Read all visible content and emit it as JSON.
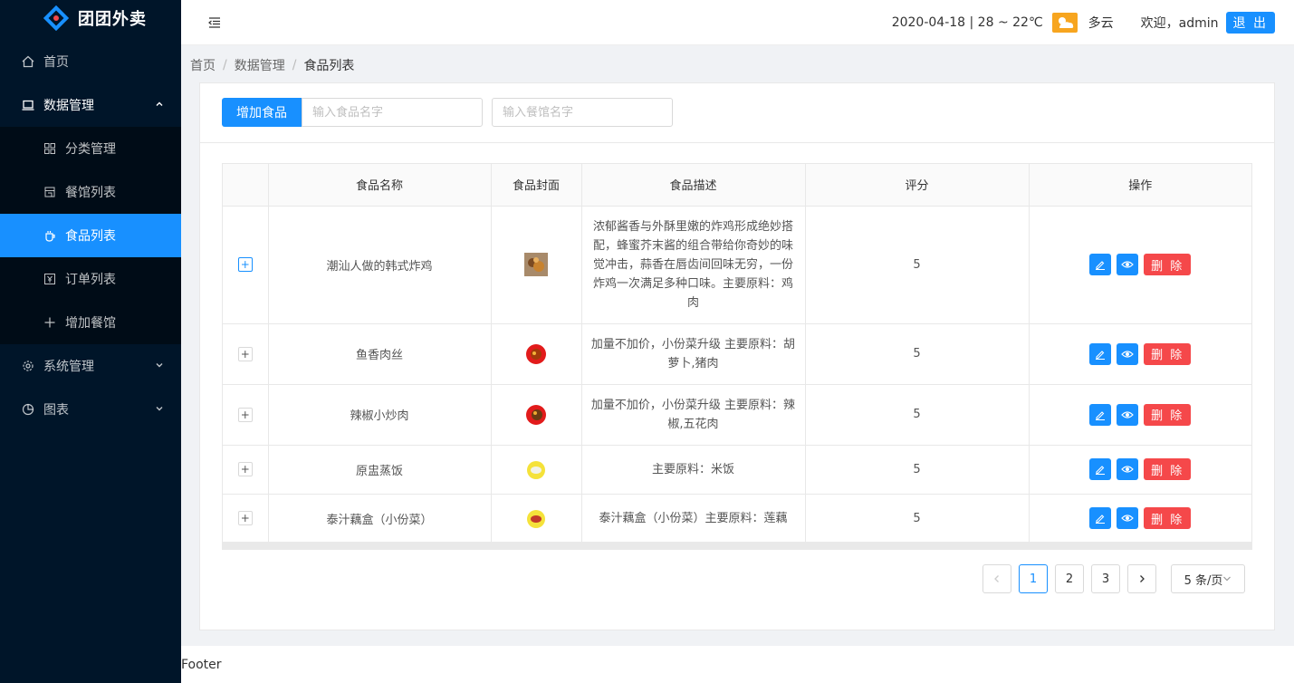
{
  "app": {
    "name": "团团外卖"
  },
  "sidebar": {
    "items": [
      {
        "label": "首页",
        "icon": "home-icon"
      },
      {
        "label": "数据管理",
        "icon": "laptop-icon",
        "open": true,
        "children": [
          {
            "label": "分类管理",
            "icon": "grid-icon"
          },
          {
            "label": "餐馆列表",
            "icon": "shop-icon"
          },
          {
            "label": "食品列表",
            "icon": "coffee-icon",
            "active": true
          },
          {
            "label": "订单列表",
            "icon": "yen-icon"
          },
          {
            "label": "增加餐馆",
            "icon": "plus-icon"
          }
        ]
      },
      {
        "label": "系统管理",
        "icon": "gear-icon"
      },
      {
        "label": "图表",
        "icon": "pie-chart-icon"
      }
    ]
  },
  "header": {
    "weather_info": "2020-04-18 | 28 ~ 22℃",
    "weather_desc": "多云",
    "welcome": "欢迎，admin",
    "logout_label": "退 出"
  },
  "breadcrumb": {
    "home": "首页",
    "section": "数据管理",
    "current": "食品列表"
  },
  "toolbar": {
    "add_label": "增加食品",
    "food_placeholder": "输入食品名字",
    "restaurant_placeholder": "输入餐馆名字"
  },
  "table": {
    "headers": {
      "name": "食品名称",
      "cover": "食品封面",
      "desc": "食品描述",
      "rating": "评分",
      "ops": "操作"
    },
    "rows": [
      {
        "name": "潮汕人做的韩式炸鸡",
        "desc": "浓郁酱香与外酥里嫩的炸鸡形成绝妙搭配，蜂蜜芥末酱的组合带给你奇妙的味觉冲击，蒜香在唇齿间回味无穷，一份炸鸡一次满足多种口味。主要原料：鸡肉",
        "rating": "5",
        "delete_label": "删 除"
      },
      {
        "name": "鱼香肉丝",
        "desc": "加量不加价，小份菜升级 主要原料：胡萝卜,猪肉",
        "rating": "5",
        "delete_label": "删 除"
      },
      {
        "name": "辣椒小炒肉",
        "desc": "加量不加价，小份菜升级 主要原料：辣椒,五花肉",
        "rating": "5",
        "delete_label": "删 除"
      },
      {
        "name": "原盅蒸饭",
        "desc": "主要原料：米饭",
        "rating": "5",
        "delete_label": "删 除"
      },
      {
        "name": "泰汁藕盒（小份菜）",
        "desc": "泰汁藕盒（小份菜）主要原料：莲藕",
        "rating": "5",
        "delete_label": "删 除"
      }
    ]
  },
  "pagination": {
    "pages": [
      "1",
      "2",
      "3"
    ],
    "current": "1",
    "page_size": "5 条/页"
  },
  "footer": {
    "text": "Footer"
  },
  "colors": {
    "primary": "#1890ff",
    "danger": "#f5484a",
    "sidebar_bg": "#001529"
  }
}
